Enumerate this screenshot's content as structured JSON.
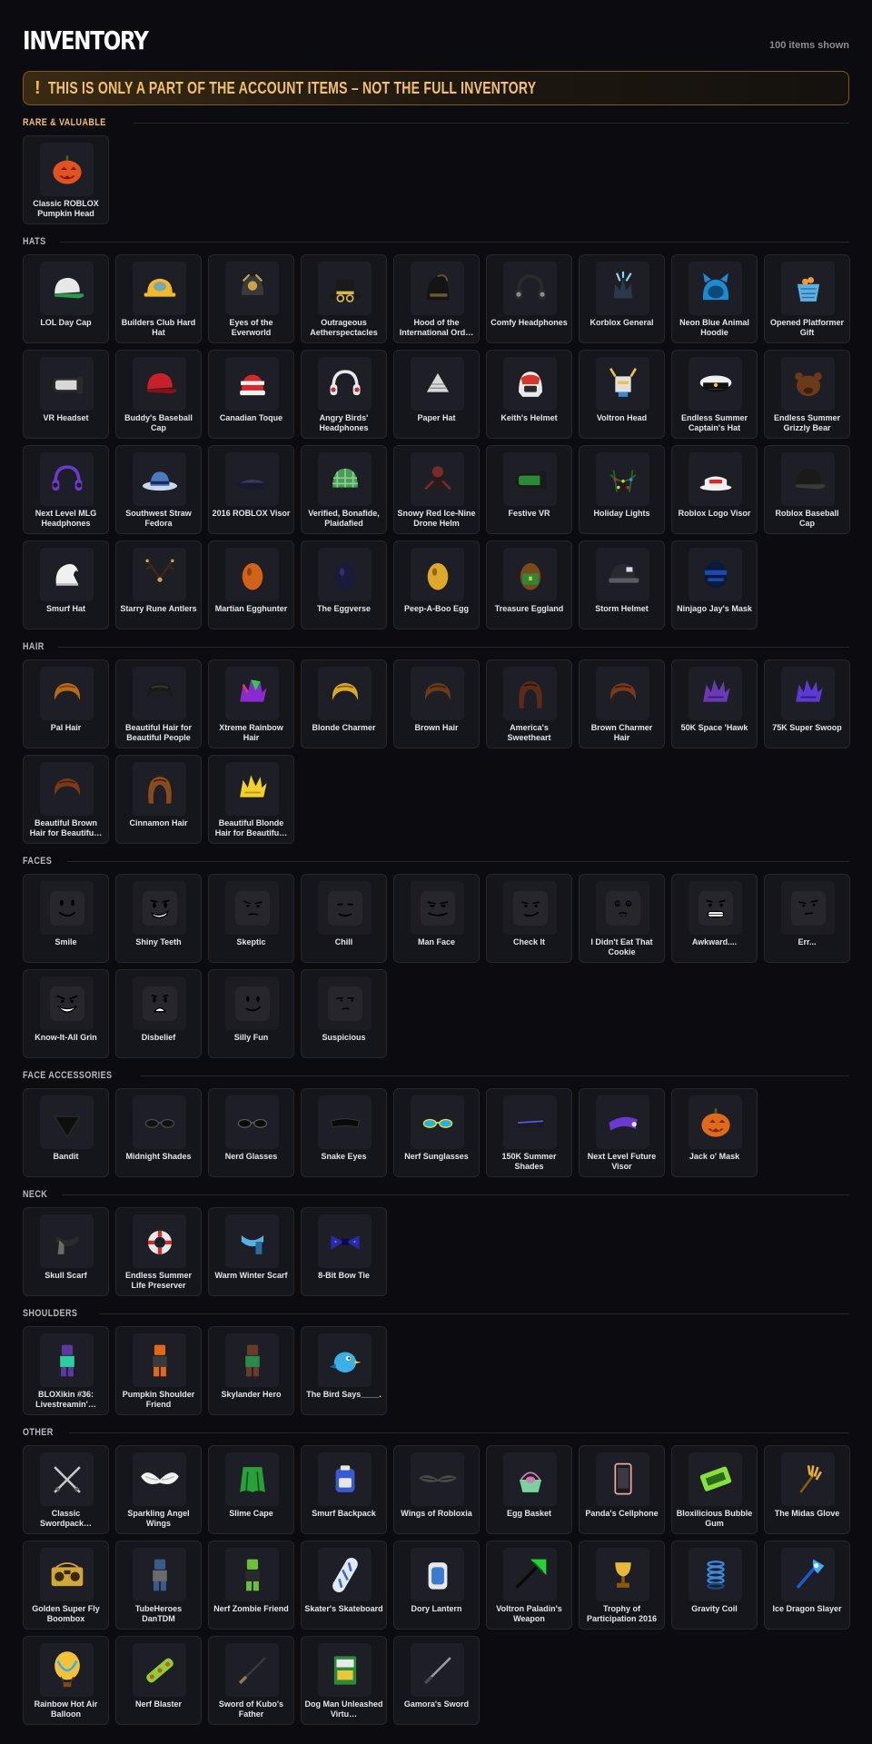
{
  "header": {
    "title": "INVENTORY",
    "count": "100 items shown"
  },
  "warning": {
    "icon": "exclamation-icon",
    "text": "THIS IS ONLY A PART OF THE ACCOUNT ITEMS – NOT THE FULL INVENTORY"
  },
  "sections": [
    {
      "title": "RARE & VALUABLE",
      "accent": "#f0c26a",
      "items": [
        {
          "name": "Classic ROBLOX Pumpkin Head",
          "icon": "pumpkin",
          "c1": "#e0521f",
          "c2": "#7a1a0a"
        }
      ]
    },
    {
      "title": "HATS",
      "items": [
        {
          "name": "LOL Day Cap",
          "icon": "cap",
          "c1": "#e8e8e8",
          "c2": "#2a9a4a"
        },
        {
          "name": "Builders Club Hard Hat",
          "icon": "hardhat",
          "c1": "#f2b92a",
          "c2": "#4a9ee6"
        },
        {
          "name": "Eyes of the Everworld",
          "icon": "helmet",
          "c1": "#c9a24a",
          "c2": "#3a3a3a"
        },
        {
          "name": "Outrageous Aetherspectacles",
          "icon": "tophat",
          "c1": "#1a1a1a",
          "c2": "#d9b74a"
        },
        {
          "name": "Hood of the International Ord…",
          "icon": "hood",
          "c1": "#141414",
          "c2": "#6a5a2a"
        },
        {
          "name": "Comfy Headphones",
          "icon": "headphones",
          "c1": "#2a2a2a",
          "c2": "#8a8a8a"
        },
        {
          "name": "Korblox General",
          "icon": "crown",
          "c1": "#2a3a4a",
          "c2": "#8fd6e6"
        },
        {
          "name": "Neon Blue Animal Hoodie",
          "icon": "hoodie",
          "c1": "#1e8ad0",
          "c2": "#0d4a7a"
        },
        {
          "name": "Opened Platformer Gift",
          "icon": "basket",
          "c1": "#5ab0e0",
          "c2": "#f29a3a"
        },
        {
          "name": "VR Headset",
          "icon": "vr",
          "c1": "#2a2a2a",
          "c2": "#d8d8d8"
        },
        {
          "name": "Buddy's Baseball Cap",
          "icon": "cap",
          "c1": "#c8202a",
          "c2": "#8a1018"
        },
        {
          "name": "Canadian Toque",
          "icon": "toque",
          "c1": "#d02a2a",
          "c2": "#f0f0f0"
        },
        {
          "name": "Angry Birds' Headphones",
          "icon": "headphones",
          "c1": "#e8e8e8",
          "c2": "#d02a2a"
        },
        {
          "name": "Paper Hat",
          "icon": "paperhat",
          "c1": "#d8d8d8",
          "c2": "#8a8a8a"
        },
        {
          "name": "Keith's Helmet",
          "icon": "helmet2",
          "c1": "#e8e8e8",
          "c2": "#d8342a"
        },
        {
          "name": "Voltron Head",
          "icon": "robothead",
          "c1": "#e0e0e0",
          "c2": "#f2c23a"
        },
        {
          "name": "Endless Summer Captain's Hat",
          "icon": "captain",
          "c1": "#f0f0f0",
          "c2": "#111111"
        },
        {
          "name": "Endless Summer Grizzly Bear",
          "icon": "bear",
          "c1": "#6a3a1a",
          "c2": "#3a1e0e"
        },
        {
          "name": "Next Level MLG Headphones",
          "icon": "headphones",
          "c1": "#6a3ad0",
          "c2": "#1a1a1a"
        },
        {
          "name": "Southwest Straw Fedora",
          "icon": "fedora",
          "c1": "#4a7ac0",
          "c2": "#c8d8e8"
        },
        {
          "name": "2016 ROBLOX Visor",
          "icon": "visor",
          "c1": "#1a1a2e",
          "c2": "#3a3a5a"
        },
        {
          "name": "Verified, Bonafide, Plaidafied",
          "icon": "plaid",
          "c1": "#4a9a5a",
          "c2": "#8ad08a"
        },
        {
          "name": "Snowy Red Ice-Nine Drone Helm",
          "icon": "drone",
          "c1": "#7a2a2a",
          "c2": "#2a1a1a"
        },
        {
          "name": "Festive VR",
          "icon": "vr",
          "c1": "#1a1a1a",
          "c2": "#2a8a3a"
        },
        {
          "name": "Holiday Lights",
          "icon": "lights",
          "c1": "#1e6a2a",
          "c2": "#d02a2a"
        },
        {
          "name": "Roblox Logo Visor",
          "icon": "visor2",
          "c1": "#f0f0f0",
          "c2": "#d02a2a"
        },
        {
          "name": "Roblox Baseball Cap",
          "icon": "cap",
          "c1": "#1a1a1a",
          "c2": "#3a3a3a"
        },
        {
          "name": "Smurf Hat",
          "icon": "smurf",
          "c1": "#f0f0f0",
          "c2": "#c0c0c0"
        },
        {
          "name": "Starry Rune Antlers",
          "icon": "antlers",
          "c1": "#3a2a1a",
          "c2": "#d2a24a"
        },
        {
          "name": "Martian Egghunter",
          "icon": "egg",
          "c1": "#d0621a",
          "c2": "#7a2a0a"
        },
        {
          "name": "The Eggverse",
          "icon": "egg",
          "c1": "#1a1a3a",
          "c2": "#4a3a9a"
        },
        {
          "name": "Peep-A-Boo Egg",
          "icon": "egg",
          "c1": "#e0a82a",
          "c2": "#5a3a1a"
        },
        {
          "name": "Treasure Eggland",
          "icon": "chest",
          "c1": "#7a4a1a",
          "c2": "#2a8a3a"
        },
        {
          "name": "Storm Helmet",
          "icon": "stormhelmet",
          "c1": "#2a2a2e",
          "c2": "#5a5a64"
        },
        {
          "name": "Ninjago Jay's Mask",
          "icon": "mask",
          "c1": "#1a4ab0",
          "c2": "#0a1a3a"
        }
      ]
    },
    {
      "title": "HAIR",
      "items": [
        {
          "name": "Pal Hair",
          "icon": "hair",
          "c1": "#b86a1a",
          "c2": "#7a3e0a"
        },
        {
          "name": "Beautiful Hair for Beautiful People",
          "icon": "hair",
          "c1": "#1a1a1a",
          "c2": "#3a3a3a"
        },
        {
          "name": "Xtreme Rainbow Hair",
          "icon": "rainbowhair",
          "c1": "#8a2ad0",
          "c2": "#2ad04a"
        },
        {
          "name": "Blonde Charmer",
          "icon": "hair",
          "c1": "#d8a82a",
          "c2": "#8a5a0a"
        },
        {
          "name": "Brown Hair",
          "icon": "hair",
          "c1": "#6a3a1a",
          "c2": "#3a1e0a"
        },
        {
          "name": "America's Sweetheart",
          "icon": "longhair",
          "c1": "#5a2a1a",
          "c2": "#2a120a"
        },
        {
          "name": "Brown Charmer Hair",
          "icon": "hair",
          "c1": "#7a3a1a",
          "c2": "#3a1a0a"
        },
        {
          "name": "50K Space 'Hawk",
          "icon": "spikyhair",
          "c1": "#6a3ab0",
          "c2": "#3a1a7a"
        },
        {
          "name": "75K Super Swoop",
          "icon": "spikyhair",
          "c1": "#5a3ad0",
          "c2": "#2a1a8a"
        },
        {
          "name": "Beautiful Brown Hair for Beautifu…",
          "icon": "hair",
          "c1": "#7a3a1a",
          "c2": "#4a1e0a"
        },
        {
          "name": "Cinnamon Hair",
          "icon": "longhair",
          "c1": "#8a4a1a",
          "c2": "#4a220a"
        },
        {
          "name": "Beautiful Blonde Hair for Beautifu…",
          "icon": "spikyhair",
          "c1": "#f2d22a",
          "c2": "#b8941a"
        }
      ]
    },
    {
      "title": "FACES",
      "items": [
        {
          "name": "Smile",
          "icon": "face-smile",
          "c1": "#000000",
          "c2": "#ffffff"
        },
        {
          "name": "Shiny Teeth",
          "icon": "face-teeth",
          "c1": "#000000",
          "c2": "#ffffff"
        },
        {
          "name": "Skeptic",
          "icon": "face-skeptic",
          "c1": "#000000",
          "c2": "#ffffff"
        },
        {
          "name": "Chill",
          "icon": "face-chill",
          "c1": "#000000",
          "c2": "#ffffff"
        },
        {
          "name": "Man Face",
          "icon": "face-man",
          "c1": "#000000",
          "c2": "#ffffff"
        },
        {
          "name": "Check It",
          "icon": "face-checkit",
          "c1": "#000000",
          "c2": "#ffffff"
        },
        {
          "name": "I Didn't Eat That Cookie",
          "icon": "face-cookie",
          "c1": "#000000",
          "c2": "#ffffff"
        },
        {
          "name": "Awkward....",
          "icon": "face-awkward",
          "c1": "#000000",
          "c2": "#ffffff"
        },
        {
          "name": "Err...",
          "icon": "face-err",
          "c1": "#000000",
          "c2": "#ffffff"
        },
        {
          "name": "Know-It-All Grin",
          "icon": "face-grin",
          "c1": "#000000",
          "c2": "#ffffff"
        },
        {
          "name": "Disbelief",
          "icon": "face-disbelief",
          "c1": "#000000",
          "c2": "#ffffff"
        },
        {
          "name": "Silly Fun",
          "icon": "face-silly",
          "c1": "#000000",
          "c2": "#ffffff"
        },
        {
          "name": "Suspicious",
          "icon": "face-suspicious",
          "c1": "#000000",
          "c2": "#ffffff"
        }
      ]
    },
    {
      "title": "FACE ACCESSORIES",
      "items": [
        {
          "name": "Bandit",
          "icon": "bandana",
          "c1": "#0e0e0e",
          "c2": "#2a2a2a"
        },
        {
          "name": "Midnight Shades",
          "icon": "glasses",
          "c1": "#111111",
          "c2": "#4a4a4a"
        },
        {
          "name": "Nerd Glasses",
          "icon": "glasses",
          "c1": "#0a0a0a",
          "c2": "#5a5a5a"
        },
        {
          "name": "Snake Eyes",
          "icon": "visorband",
          "c1": "#0a0a0a",
          "c2": "#3a3a3a"
        },
        {
          "name": "Nerf Sunglasses",
          "icon": "glasses",
          "c1": "#2ab0e0",
          "c2": "#f2e22a"
        },
        {
          "name": "150K Summer Shades",
          "icon": "shades",
          "c1": "#1a1a2a",
          "c2": "#5a5ad0"
        },
        {
          "name": "Next Level Future Visor",
          "icon": "futurevisor",
          "c1": "#6a3ad0",
          "c2": "#3a1e8a"
        },
        {
          "name": "Jack o' Mask",
          "icon": "pumpkin",
          "c1": "#e06a1a",
          "c2": "#7a2a0a"
        }
      ]
    },
    {
      "title": "NECK",
      "items": [
        {
          "name": "Skull Scarf",
          "icon": "scarf",
          "c1": "#2a2a2a",
          "c2": "#8a8a8a"
        },
        {
          "name": "Endless Summer Life Preserver",
          "icon": "preserver",
          "c1": "#e8e8e8",
          "c2": "#d02a2a"
        },
        {
          "name": "Warm Winter Scarf",
          "icon": "scarf2",
          "c1": "#5ab0e0",
          "c2": "#2a6aa0"
        },
        {
          "name": "8-Bit Bow Tie",
          "icon": "bowtie",
          "c1": "#2a2ab0",
          "c2": "#0a0a4a"
        }
      ]
    },
    {
      "title": "SHOULDERS",
      "items": [
        {
          "name": "BLOXikin #36: Livestreamin'…",
          "icon": "figure",
          "c1": "#5a3a9a",
          "c2": "#2ad0a0"
        },
        {
          "name": "Pumpkin Shoulder Friend",
          "icon": "figure",
          "c1": "#e06a1a",
          "c2": "#3a3a3a"
        },
        {
          "name": "Skylander Hero",
          "icon": "figure",
          "c1": "#6a3a2a",
          "c2": "#2a8a4a"
        },
        {
          "name": "The Bird Says____.",
          "icon": "bird",
          "c1": "#3ab0e6",
          "c2": "#1a6aa0"
        }
      ]
    },
    {
      "title": "OTHER",
      "items": [
        {
          "name": "Classic Swordpack…",
          "icon": "swords",
          "c1": "#c8c8c8",
          "c2": "#6a6a6a"
        },
        {
          "name": "Sparkling Angel Wings",
          "icon": "wings",
          "c1": "#f0f0f0",
          "c2": "#b0b0b8"
        },
        {
          "name": "Slime Cape",
          "icon": "cape",
          "c1": "#2aa03a",
          "c2": "#0e5a1a"
        },
        {
          "name": "Smurf Backpack",
          "icon": "backpack",
          "c1": "#3a5ad0",
          "c2": "#e8e8e8"
        },
        {
          "name": "Wings of Robloxia",
          "icon": "darkwings",
          "c1": "#1a1a1a",
          "c2": "#4a4a4a"
        },
        {
          "name": "Egg Basket",
          "icon": "eggbasket",
          "c1": "#7ad0a0",
          "c2": "#d07ab0"
        },
        {
          "name": "Panda's Cellphone",
          "icon": "phone",
          "c1": "#e8a8a8",
          "c2": "#1a1a1a"
        },
        {
          "name": "Bloxilicious Bubble Gum",
          "icon": "gum",
          "c1": "#8ae03a",
          "c2": "#2a6a1a"
        },
        {
          "name": "The Midas Glove",
          "icon": "glove",
          "c1": "#e0b03a",
          "c2": "#8a5a0a"
        },
        {
          "name": "Golden Super Fly Boombox",
          "icon": "boombox",
          "c1": "#d0a83a",
          "c2": "#3a2a0a"
        },
        {
          "name": "TubeHeroes DanTDM",
          "icon": "figure",
          "c1": "#3a5a8a",
          "c2": "#6a6a6a"
        },
        {
          "name": "Nerf Zombie Friend",
          "icon": "figure",
          "c1": "#6ac03a",
          "c2": "#2a2a2a"
        },
        {
          "name": "Skater's Skateboard",
          "icon": "skateboard",
          "c1": "#e0e8f0",
          "c2": "#3a6ad0"
        },
        {
          "name": "Dory Lantern",
          "icon": "lantern",
          "c1": "#3a7ad0",
          "c2": "#e8e8e8"
        },
        {
          "name": "Voltron Paladin's Weapon",
          "icon": "paladin",
          "c1": "#2ad03a",
          "c2": "#0a0a0a"
        },
        {
          "name": "Trophy of Participation 2016",
          "icon": "trophy",
          "c1": "#e8b83a",
          "c2": "#8a5a0a"
        },
        {
          "name": "Gravity Coil",
          "icon": "coil",
          "c1": "#3a8ae0",
          "c2": "#1a4a8a"
        },
        {
          "name": "Ice Dragon Slayer",
          "icon": "icesword",
          "c1": "#3ab0f0",
          "c2": "#1a5ad0"
        },
        {
          "name": "Rainbow Hot Air Balloon",
          "icon": "balloon",
          "c1": "#f2c23a",
          "c2": "#3ab0e6"
        },
        {
          "name": "Nerf Blaster",
          "icon": "blaster",
          "c1": "#8ad03a",
          "c2": "#d05a1a"
        },
        {
          "name": "Sword of Kubo's Father",
          "icon": "katana",
          "c1": "#3a3a3a",
          "c2": "#8a7a5a"
        },
        {
          "name": "Dog Man Unleashed Virtu…",
          "icon": "book",
          "c1": "#2a8a3a",
          "c2": "#e8e8e8"
        },
        {
          "name": "Gamora's Sword",
          "icon": "katana",
          "c1": "#9a9aa4",
          "c2": "#4a4a52"
        }
      ]
    }
  ]
}
